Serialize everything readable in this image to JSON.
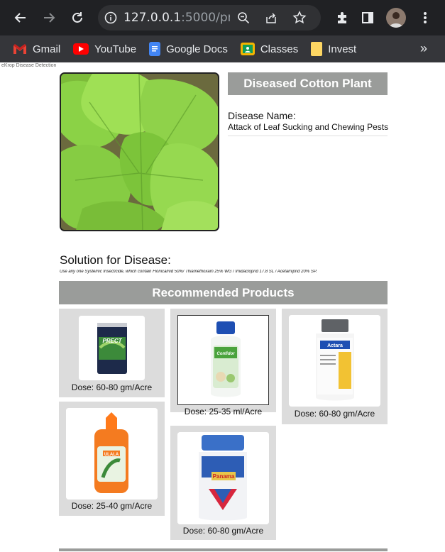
{
  "browser": {
    "url": "127.0.0.1:5000/pr...",
    "url_host": "127.0.0.1",
    "url_rest": ":5000/pr...",
    "bookmarks": [
      {
        "label": "Gmail",
        "icon": "gmail-icon",
        "color": "#ea4335"
      },
      {
        "label": "YouTube",
        "icon": "youtube-icon",
        "color": "#ff0000"
      },
      {
        "label": "Google Docs",
        "icon": "docs-icon",
        "color": "#4285f4"
      },
      {
        "label": "Classes",
        "icon": "classroom-icon",
        "color": "#f4b400"
      },
      {
        "label": "Invest",
        "icon": "folder-icon",
        "color": "#fdd663"
      }
    ],
    "more_label": "»"
  },
  "page": {
    "broken_image_alt": "eKrop Disease Detection",
    "plant_title": "Diseased Cotton Plant",
    "disease_label": "Disease Name:",
    "disease_value": "Attack of Leaf Sucking and Chewing Pests",
    "solution_title": "Solution for Disease:",
    "solution_text": "Use any one Systemic Insecticide, which contain Flonicamid 50%/ Thiamethoxam 25% WG / Imidacloprid 17.8 SL / Acetamiprid 20% SP.",
    "recommended_title": "Recommended Products"
  },
  "products": [
    {
      "dose": "Dose: 60-80 gm/Acre",
      "brand": "PRECT"
    },
    {
      "dose": "Dose: 25-40 gm/Acre",
      "brand": "ULALA"
    },
    {
      "dose": "Dose: 25-35 ml/Acre",
      "brand": "Confidor"
    },
    {
      "dose": "Dose: 60-80 gm/Acre",
      "brand": "Panama"
    },
    {
      "dose": "Dose: 60-80 gm/Acre",
      "brand": "Actara"
    }
  ],
  "colors": {
    "chrome_dark": "#202124",
    "bookmark_bar": "#35363a",
    "header_gray": "#9a9c9a",
    "card_gray": "#dcdcdc"
  }
}
